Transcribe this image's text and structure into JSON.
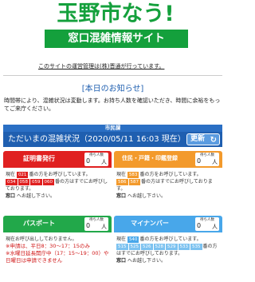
{
  "site": {
    "logo_text": "玉野市なう!",
    "subtitle": "窓口混雑情報サイト",
    "operator": "このサイトの運営管理は(株)晋通が行っています。"
  },
  "notice": {
    "title": "[本日のお知らせ]",
    "body": "時間帯により、混雑状況は変動します。お持ち人数を確認いただき、時間に余裕をもってご来庁ください。"
  },
  "status": {
    "department": "市民課",
    "headline": "ただいまの混雑状況（2020/05/11 16:03 現在）",
    "refresh_label": "更新"
  },
  "cards": [
    {
      "title": "証明書発行",
      "wait_label": "待ち人数",
      "wait_count": "0",
      "wait_unit": "人",
      "current_prefix": "現在",
      "current_number": "021",
      "current_suffix": "番の方をお呼びしています。",
      "next_numbers": [
        "034",
        "058",
        "059",
        "060"
      ],
      "next_suffix": "番の方はすでにお呼びしております。",
      "window_prefix": "窓口",
      "window_suffix": "へお越し下さい。"
    },
    {
      "title": "住民・戸籍・印鑑登録",
      "wait_label": "待ち人数",
      "wait_count": "0",
      "wait_unit": "人",
      "current_prefix": "現在",
      "current_number": "583",
      "current_suffix": "番の方をお呼びしています。",
      "next_numbers": [
        "586",
        "587"
      ],
      "next_suffix": "番の方はすでにお呼びしております。",
      "window_prefix": "窓口",
      "window_suffix": "へお越し下さい。"
    },
    {
      "title": "パスポート",
      "wait_label": "待ち人数",
      "wait_count": "0",
      "wait_unit": "人",
      "line1": "現在お呼び出ししておりません。",
      "note1": "※申請は、平日8：30～17：15のみ",
      "note2": "※水曜日延長開庁中（17：15～19：00）や日曜日は申請できません"
    },
    {
      "title": "マイナンバー",
      "wait_label": "待ち人数",
      "wait_count": "0",
      "wait_unit": "人",
      "current_prefix": "現在",
      "current_number": "540",
      "current_suffix": "番の方をお呼びしています。",
      "next_numbers": [
        "515",
        "525",
        "526",
        "528",
        "529",
        "533",
        "535"
      ],
      "next_suffix": "番の方はすでにお呼びしております。",
      "window_prefix": "窓口",
      "window_suffix": "へお越し下さい。"
    }
  ]
}
